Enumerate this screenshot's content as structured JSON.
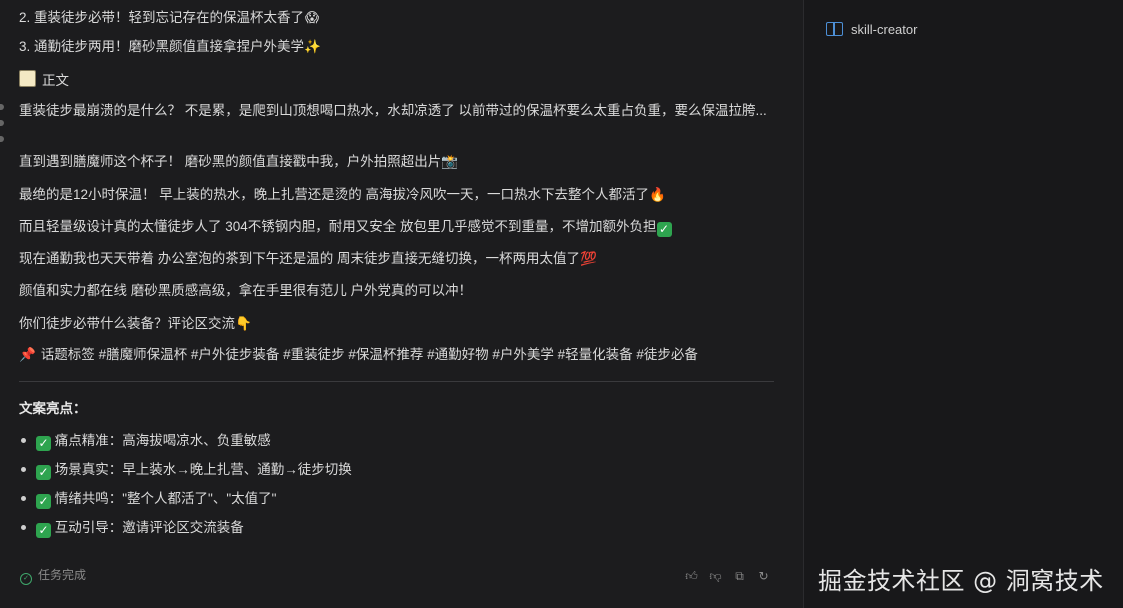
{
  "content": {
    "list_item_2": "2. 重装徒步必带！轻到忘记存在的保温杯太香了",
    "list_item_3": "3. 通勤徒步两用！磨砂黑颜值直接拿捏户外美学",
    "body_heading": "正文",
    "para1": "重装徒步最崩溃的是什么？ 不是累，是爬到山顶想喝口热水，水却凉透了 以前带过的保温杯要么太重占负重，要么保温拉胯...",
    "para2": "直到遇到膳魔师这个杯子！ 磨砂黑的颜值直接戳中我，户外拍照超出片",
    "para3": "最绝的是12小时保温！ 早上装的热水，晚上扎营还是烫的 高海拔冷风吹一天，一口热水下去整个人都活了",
    "para4": "而且轻量级设计真的太懂徒步人了 304不锈钢内胆，耐用又安全 放包里几乎感觉不到重量，不增加额外负担",
    "para5": "现在通勤我也天天带着 办公室泡的茶到下午还是温的 周末徒步直接无缝切换，一杯两用太值了",
    "para6": "颜值和实力都在线 磨砂黑质感高级，拿在手里很有范儿 户外党真的可以冲！",
    "para7": "你们徒步必带什么装备？评论区交流",
    "tags": "话题标签 #膳魔师保温杯 #户外徒步装备 #重装徒步 #保温杯推荐 #通勤好物 #户外美学 #轻量化装备 #徒步必备"
  },
  "highlights": {
    "title": "文案亮点：",
    "items": [
      {
        "label": "痛点精准：高海拔喝凉水、负重敏感"
      },
      {
        "label": "场景真实：早上装水→晚上扎营、通勤→徒步切换"
      },
      {
        "label": "情绪共鸣：\"整个人都活了\"、\"太值了\""
      },
      {
        "label": "互动引导：邀请评论区交流装备"
      }
    ]
  },
  "status": {
    "label": "任务完成"
  },
  "sidebar": {
    "skill": "skill-creator"
  },
  "watermark": "掘金技术社区 @ 洞窝技术",
  "emoji": {
    "scream": "😱",
    "sparkles": "✨",
    "cold": "🥶",
    "camera": "📸",
    "fire": "🔥",
    "check": "✓",
    "hundred": "💯",
    "point_down": "👇",
    "pin": "📌"
  },
  "colors": {
    "accent_green": "#2ea44f",
    "link_blue": "#4d8fd6",
    "bg": "#1c1c1e"
  }
}
